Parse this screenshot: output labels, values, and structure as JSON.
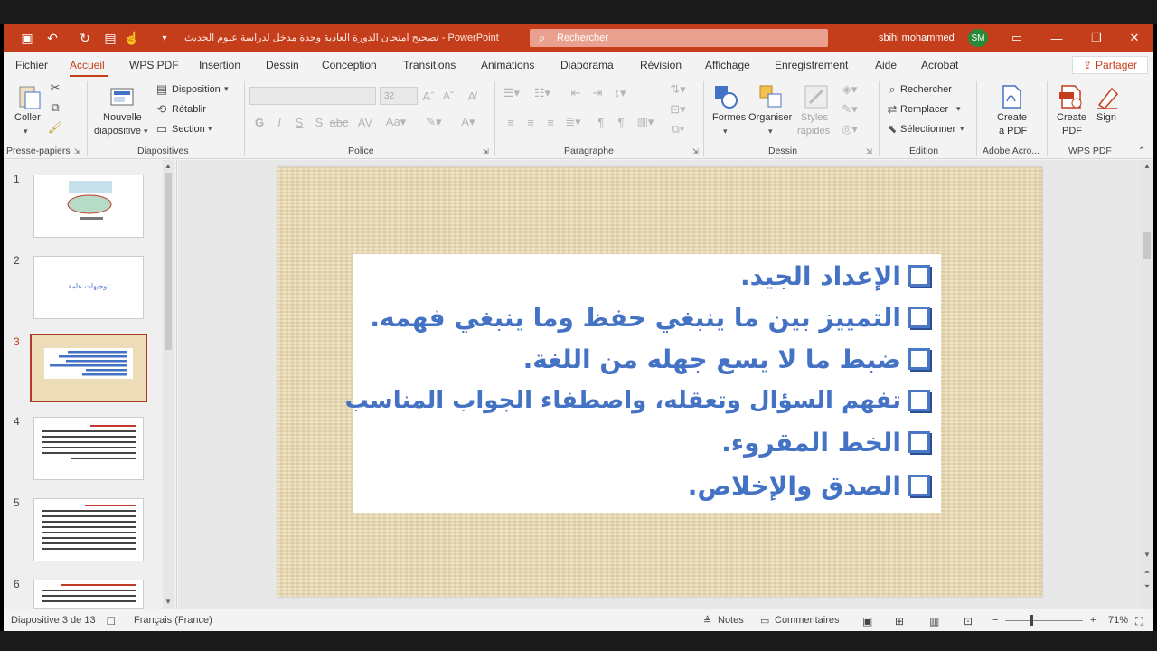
{
  "window": {
    "doc_title": "تصحيح امتحان الدورة العادية وحدة مدخل لدراسة علوم الحديث - PowerPoint",
    "search_placeholder": "Rechercher",
    "user_name": "sbihi mohammed",
    "user_initials": "SM"
  },
  "tabs": [
    "Fichier",
    "Accueil",
    "WPS PDF",
    "Insertion",
    "Dessin",
    "Conception",
    "Transitions",
    "Animations",
    "Diaporama",
    "Révision",
    "Affichage",
    "Enregistrement",
    "Aide",
    "Acrobat"
  ],
  "active_tab": "Accueil",
  "share_label": "Partager",
  "ribbon": {
    "clipboard": {
      "paste": "Coller",
      "group": "Presse-papiers"
    },
    "slides": {
      "new_slide_1": "Nouvelle",
      "new_slide_2": "diapositive",
      "layout": "Disposition",
      "reset": "Rétablir",
      "section": "Section",
      "group": "Diapositives"
    },
    "font": {
      "size": "32",
      "group": "Police"
    },
    "paragraph": {
      "group": "Paragraphe"
    },
    "drawing": {
      "shapes": "Formes",
      "arrange": "Organiser",
      "quick_styles_1": "Styles",
      "quick_styles_2": "rapides",
      "group": "Dessin"
    },
    "editing": {
      "find": "Rechercher",
      "replace": "Remplacer",
      "select": "Sélectionner",
      "group": "Édition"
    },
    "adobe": {
      "create_1": "Create",
      "create_2": "a PDF",
      "group": "Adobe Acro..."
    },
    "wps": {
      "create_1": "Create",
      "create_2": "PDF",
      "sign": "Sign",
      "group": "WPS PDF"
    }
  },
  "thumbnails": [
    {
      "num": "1",
      "active": false
    },
    {
      "num": "2",
      "active": false,
      "text": "توجيهات عامة"
    },
    {
      "num": "3",
      "active": true
    },
    {
      "num": "4",
      "active": false
    },
    {
      "num": "5",
      "active": false
    },
    {
      "num": "6",
      "active": false
    }
  ],
  "slide": {
    "bullets": [
      "الإعداد الجيد.",
      "التمييز بين ما ينبغي حفظ وما ينبغي فهمه.",
      "ضبط ما لا يسع جهله من اللغة.",
      "تفهم السؤال وتعقله، واصطفاء الجواب المناسب",
      "الخط المقروء.",
      "الصدق والإخلاص."
    ]
  },
  "status": {
    "slide_pos": "Diapositive 3 de 13",
    "language": "Français (France)",
    "notes": "Notes",
    "comments": "Commentaires",
    "zoom": "71%"
  }
}
